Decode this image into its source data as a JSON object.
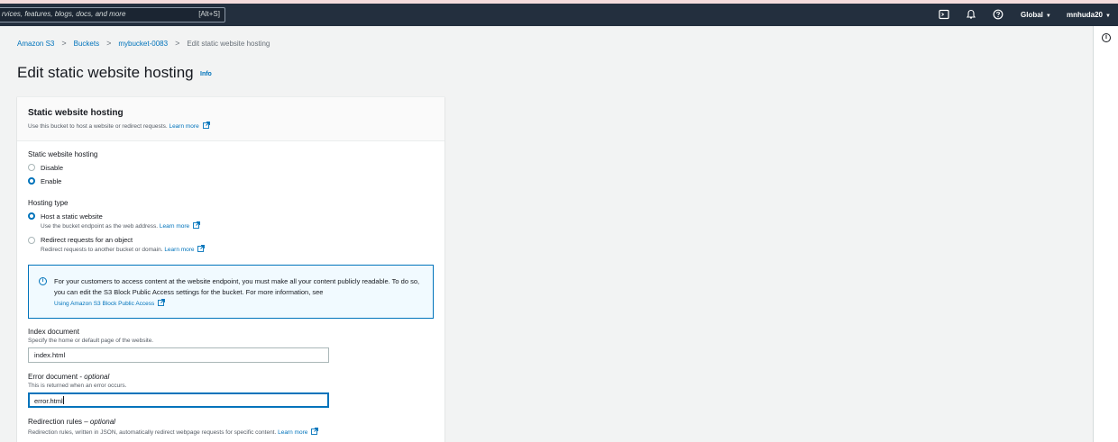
{
  "navbar": {
    "search_placeholder": "rvices, features, blogs, docs, and more",
    "search_shortcut": "[Alt+S]",
    "region": "Global",
    "user": "mnhuda20"
  },
  "breadcrumb": {
    "items": [
      "Amazon S3",
      "Buckets",
      "mybucket-0083"
    ],
    "current": "Edit static website hosting"
  },
  "page": {
    "title": "Edit static website hosting",
    "info": "Info"
  },
  "panel": {
    "title": "Static website hosting",
    "description": "Use this bucket to host a website or redirect requests.",
    "learn_more": "Learn more",
    "hosting_label": "Static website hosting",
    "hosting_options": [
      "Disable",
      "Enable"
    ],
    "hosting_selected": "Enable",
    "type_label": "Hosting type",
    "type_options": [
      {
        "label": "Host a static website",
        "description": "Use the bucket endpoint as the web address."
      },
      {
        "label": "Redirect requests for an object",
        "description": "Redirect requests to another bucket or domain."
      }
    ],
    "type_selected": "Host a static website",
    "alert_text": "For your customers to access content at the website endpoint, you must make all your content publicly readable. To do so, you can edit the S3 Block Public Access settings for the bucket. For more information, see",
    "alert_link": "Using Amazon S3 Block Public Access",
    "index_label": "Index document",
    "index_desc": "Specify the home or default page of the website.",
    "index_value": "index.html",
    "error_label": "Error document - ",
    "error_optional": "optional",
    "error_desc": "This is returned when an error occurs.",
    "error_value": "error.html",
    "redirect_label": "Redirection rules – ",
    "redirect_optional": "optional",
    "redirect_desc": "Redirection rules, written in JSON, automatically redirect webpage requests for specific content."
  }
}
